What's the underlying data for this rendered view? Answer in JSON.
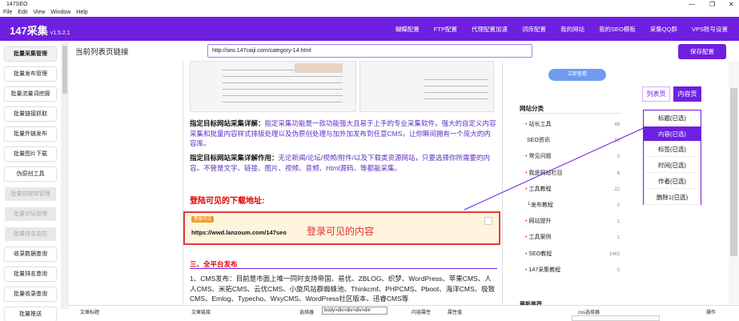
{
  "window": {
    "title": "147SEO",
    "controls": {
      "minimize": "—",
      "maximize": "❐",
      "close": "✕"
    }
  },
  "menu": [
    "File",
    "Edit",
    "View",
    "Window",
    "Help"
  ],
  "header": {
    "brand": "147采集",
    "version": "v1.5.2.1",
    "nav": [
      "蝴蝶配置",
      "FTP配置",
      "代理配置加速",
      "词库配置",
      "我的网站",
      "我的SEO模板",
      "采集QQ群",
      "VPS账号设置"
    ]
  },
  "sidebar": {
    "items": [
      {
        "label": "批量采集管理",
        "state": "active"
      },
      {
        "label": "批量发布管理",
        "state": "normal"
      },
      {
        "label": "批量流量词挖掘",
        "state": "normal"
      },
      {
        "label": "批量链接抓取",
        "state": "normal"
      },
      {
        "label": "批量外链发布",
        "state": "normal"
      },
      {
        "label": "批量图片下载",
        "state": "normal"
      },
      {
        "label": "伪原创工具",
        "state": "normal"
      },
      {
        "label": "批量自媒体管理",
        "state": "disabled"
      },
      {
        "label": "批量论坛管理",
        "state": "disabled"
      },
      {
        "label": "批量排名监控",
        "state": "disabled"
      },
      {
        "label": "收录数据查询",
        "state": "normal"
      },
      {
        "label": "批量排名查询",
        "state": "normal"
      },
      {
        "label": "批量收录查询",
        "state": "normal"
      },
      {
        "label": "批量推送",
        "state": "normal"
      }
    ]
  },
  "urlbar": {
    "label": "当前列表页链接",
    "value": "http://seo.147caiji.com/category-14.html",
    "save_label": "保存配置"
  },
  "preview": {
    "p1_bold": "指定目标网站采集详解：",
    "p1_text": "指定采集功能是一款功能强大且易于上手的专业采集软件，强大的自定义内容采集和批量内容样式排版处理以及伪原创处理与加外加发布到任意CMS，让你瞬间拥有一个庞大的内容库。",
    "p2_bold": "指定目标网站采集详解作用：",
    "p2_text": "无论新闻/论坛/视频/附件/以及下载类资源网站，只要选择你所需要的内容。不管是文字、链接、图片、视频、音频、Html源码、等都能采集。",
    "red_title": "登陆可见的下载地址:",
    "hide_tag": "登录可见",
    "hide_link": "https://wwd.lanzoum.com/147seo",
    "hide_content": "登录可见的内容",
    "sub3": "三、全平台发布",
    "p3_text": "1、CMS发布：目前是市面上唯一同时支持帝国、易优、ZBLOG、织梦、WordPress、苹果CMS、人人CMS、米拓CMS、云优CMS、小旋风站群蜘蛛池、Thinkcmf、PHPCMS、Pboot、海洋CMS、极致CMS、Emlog、Typecho、WxyCMS、WordPress社区版本、迅睿CMS等"
  },
  "site_panel": {
    "button": "立即查看",
    "heading": "网站分类",
    "items": [
      {
        "label": "站长工具",
        "count": "48",
        "dot": true
      },
      {
        "label": "SEO资讯",
        "count": "16",
        "dot": false
      },
      {
        "label": "常见问题",
        "count": "0",
        "dot": true
      },
      {
        "label": "我是网站栏目",
        "count": "6",
        "dot": true
      },
      {
        "label": "工具教程",
        "count": "22",
        "dot": true
      },
      {
        "label": "└发布教程",
        "count": "0",
        "dot": false
      },
      {
        "label": "网站提升",
        "count": "1",
        "dot": true
      },
      {
        "label": "工具案例",
        "count": "1",
        "dot": true
      },
      {
        "label": "SEO教程",
        "count": "1463",
        "dot": true
      },
      {
        "label": "147采集教程",
        "count": "0",
        "dot": true
      }
    ],
    "more": "最新推荐"
  },
  "mode_buttons": {
    "list": "列表页",
    "content": "内容页"
  },
  "fields": [
    {
      "label": "标题(已选)",
      "selected": false
    },
    {
      "label": "内容(已选)",
      "selected": true
    },
    {
      "label": "标签(已选)",
      "selected": false
    },
    {
      "label": "时间(已选)",
      "selected": false
    },
    {
      "label": "作者(已选)",
      "selected": false
    },
    {
      "label": "删除1(已选)",
      "selected": false
    }
  ],
  "bottom": {
    "col1": "文章标题",
    "col2": "文章链接",
    "col3": "选择器",
    "selector_value": "body>div>div>div>div",
    "col4": "内容属性",
    "col5": "属性值",
    "col6": "css选择器",
    "col7": "操作"
  },
  "colors": {
    "accent": "#6f1fe0",
    "red": "#e10000"
  }
}
